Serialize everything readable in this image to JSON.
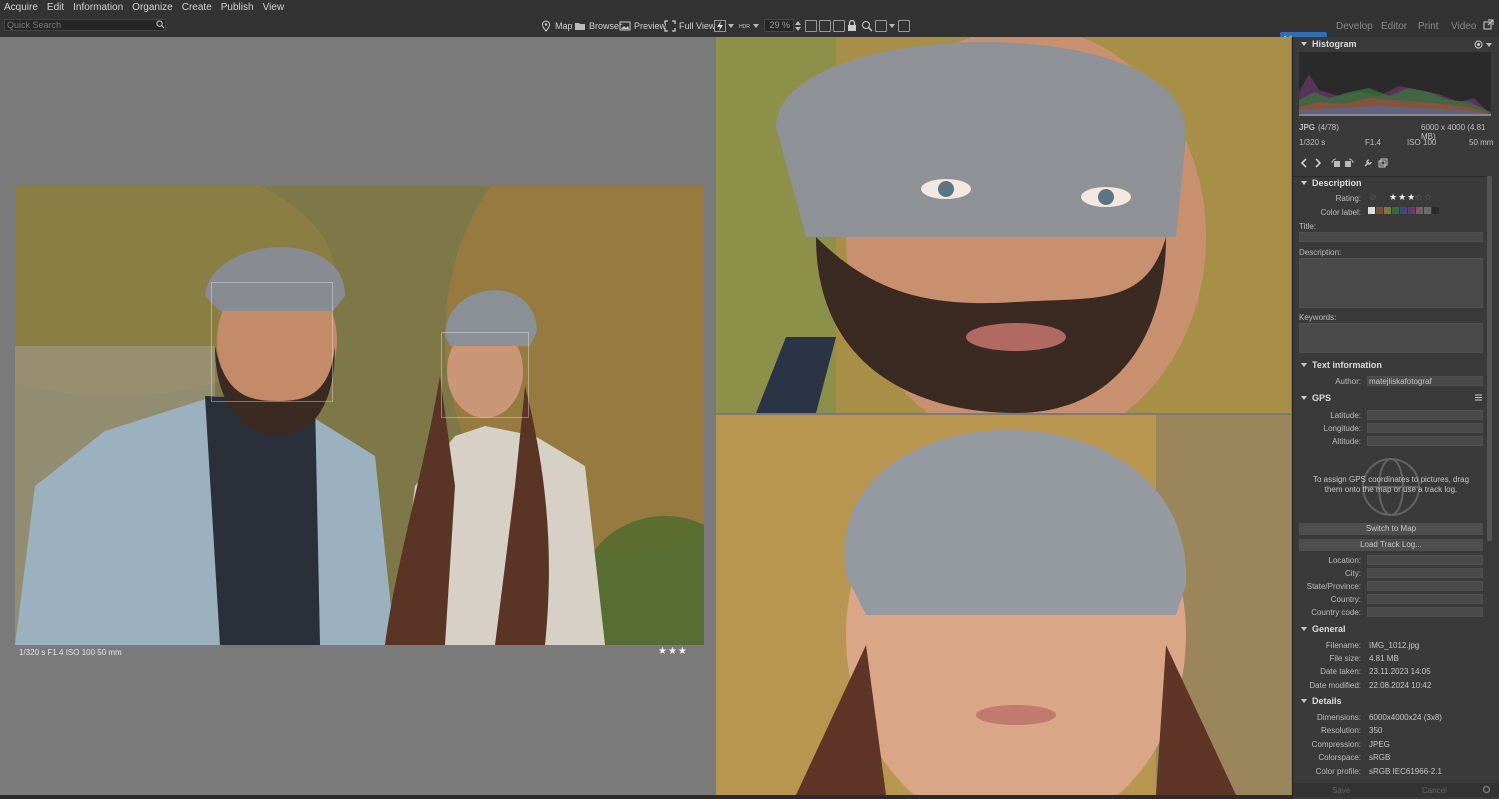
{
  "menu": [
    "Acquire",
    "Edit",
    "Information",
    "Organize",
    "Create",
    "Publish",
    "View"
  ],
  "search": {
    "placeholder": "Quick Search"
  },
  "toolbar": {
    "map": "Map",
    "browser": "Browser",
    "preview": "Preview",
    "fullview": "Full View",
    "zoom": "29 %"
  },
  "modes": {
    "manager": "Manager",
    "develop": "Develop",
    "editor": "Editor",
    "print": "Print",
    "video": "Video"
  },
  "viewer": {
    "shot_info": "1/320 s    F1.4    ISO 100    50 mm",
    "stars": "★★★"
  },
  "histogram": {
    "title": "Histogram",
    "format": "JPG",
    "index": "(4/78)",
    "size": "6000 x 4000 (4.81 MB)",
    "shutter": "1/320 s",
    "aperture": "F1.4",
    "iso": "ISO 100",
    "focal": "50 mm"
  },
  "description": {
    "title": "Description",
    "rating_label": "Rating:",
    "rating_stars": "★★★",
    "color_label": "Color label:",
    "title_label": "Title:",
    "description_label": "Description:",
    "keywords_label": "Keywords:"
  },
  "text_info": {
    "title": "Text information",
    "author_label": "Author:",
    "author": "matejliskafotograf"
  },
  "gps": {
    "title": "GPS",
    "latitude": "Latitude:",
    "longitude": "Longitude:",
    "altitude": "Altitude:",
    "hint": "To assign GPS coordinates to pictures, drag them onto the map or use a track log.",
    "switch_map": "Switch to Map",
    "load_track": "Load Track Log...",
    "location": "Location:",
    "city": "City:",
    "state": "State/Province:",
    "country": "Country:",
    "country_code": "Country code:"
  },
  "general": {
    "title": "General",
    "filename_label": "Filename:",
    "filename": "IMG_1012.jpg",
    "filesize_label": "File size:",
    "filesize": "4.81 MB",
    "date_taken_label": "Date taken:",
    "date_taken": "23.11.2023 14:05",
    "date_modified_label": "Date modified:",
    "date_modified": "22.08.2024 10:42"
  },
  "details": {
    "title": "Details",
    "dimensions_label": "Dimensions:",
    "dimensions": "6000x4000x24 (3x8)",
    "resolution_label": "Resolution:",
    "resolution": "350",
    "compression_label": "Compression:",
    "compression": "JPEG",
    "colorspace_label": "Colorspace:",
    "colorspace": "sRGB",
    "color_profile_label": "Color profile:",
    "color_profile": "sRGB IEC61966-2.1"
  },
  "footer": {
    "save": "Save",
    "cancel": "Cancel"
  },
  "colors": {
    "accent": "#2f6fb3",
    "panel": "#3a3a3a",
    "viewer_bg": "#7a7a7a"
  }
}
